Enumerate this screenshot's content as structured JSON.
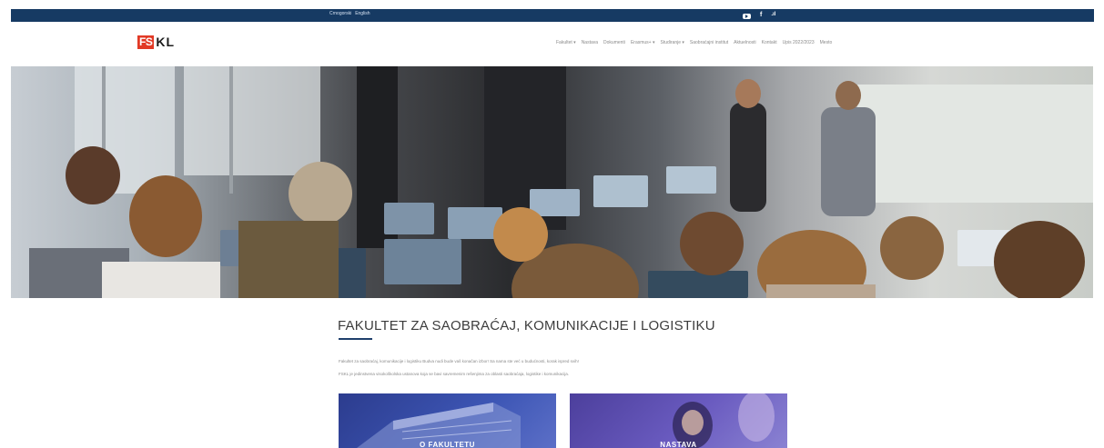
{
  "topbar": {
    "languages": [
      "Crnogorski",
      "English"
    ],
    "social_icons": [
      "youtube-icon",
      "facebook-icon",
      "wifi-icon"
    ]
  },
  "logo": {
    "fs": "FS",
    "kl": "KL"
  },
  "nav": {
    "items": [
      "Fakultet ▾",
      "Nastava",
      "Dokumenti",
      "Erasmus+ ▾",
      "Studiranje ▾",
      "Saobraćajni institut",
      "Aktuelnosti",
      "Kontakt",
      "Upis 2022/2023",
      "Mesto"
    ]
  },
  "main": {
    "title": "FAKULTET ZA SAOBRAĆAJ, KOMUNIKACIJE I LOGISTIKU",
    "para1": "Fakultet za saobraćaj, komunikacije i logistiku Budva nudi bude vaš konačan izbor! Sa nama ste već u budućnosti, korak ispred svih!",
    "para2": "FSKL je jedinstvena visokoškolska ustanova koja se bavi savremenim rešenjima za oblasti saobraćaja, logistike i komunikacija.",
    "cards": [
      {
        "label": "O FAKULTETU"
      },
      {
        "label": "NASTAVA"
      }
    ]
  },
  "colors": {
    "topbar": "#163a63",
    "logo_red": "#e23a26",
    "accent": "#1f3f6c"
  }
}
